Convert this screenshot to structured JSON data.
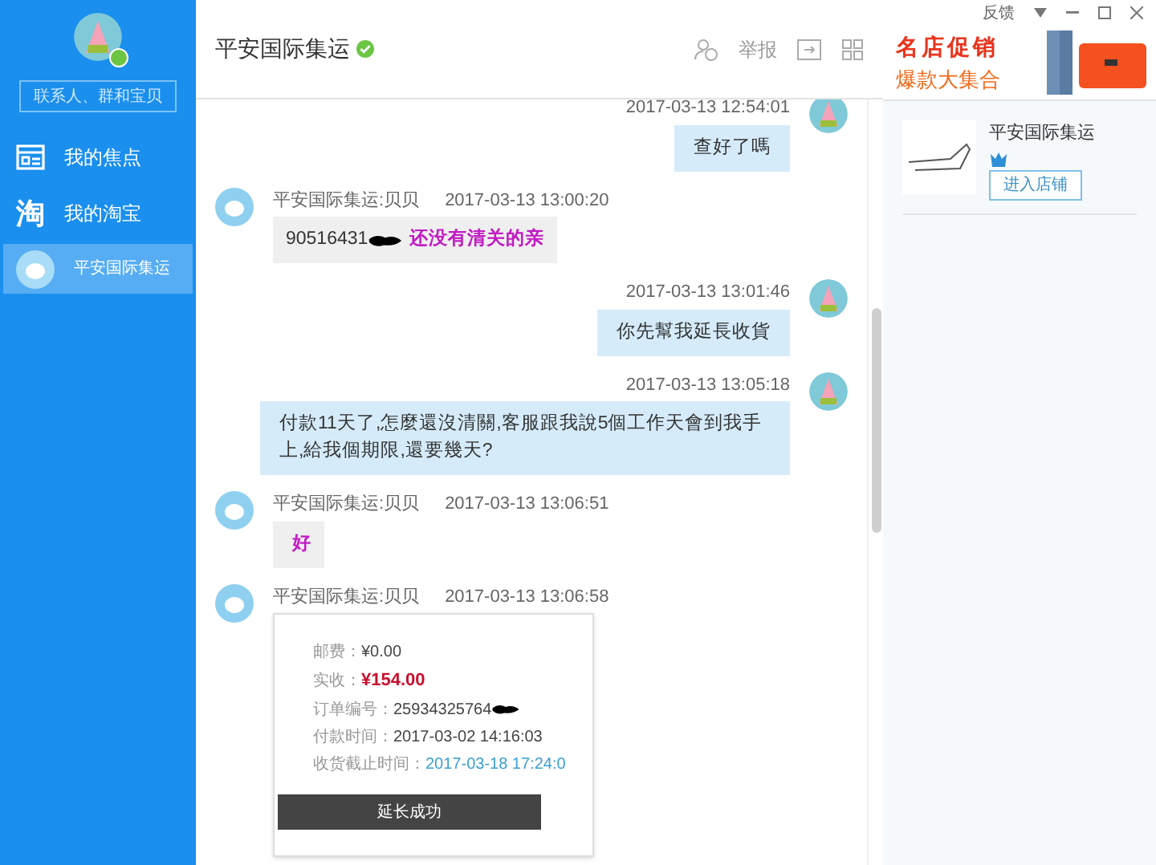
{
  "window": {
    "feedback": "反馈"
  },
  "sidebar": {
    "search": {
      "placeholder": "联系人、群和宝贝"
    },
    "items": [
      {
        "kind": "focus",
        "label": "我的焦点",
        "selected": false
      },
      {
        "kind": "taobao",
        "glyph": "淘",
        "label": "我的淘宝",
        "selected": false
      },
      {
        "kind": "contact",
        "label": "平安国际集运",
        "selected": true
      }
    ]
  },
  "chat": {
    "title": "平安国际集运",
    "verified": true,
    "report": "举报"
  },
  "ad": {
    "line1": "名店促销",
    "line2": "爆款大集合"
  },
  "messages": [
    {
      "kind": "sent",
      "time": "2017-03-13 12:54:01",
      "text": "查好了嗎"
    },
    {
      "kind": "received",
      "sender": "平安国际集运:贝贝",
      "time": "2017-03-13 13:00:20",
      "text": "90516431",
      "redacted": true,
      "highlight": "还没有清关的亲"
    },
    {
      "kind": "sent",
      "time": "2017-03-13 13:01:46",
      "text": "你先幫我延長收貨"
    },
    {
      "kind": "sent",
      "time": "2017-03-13 13:05:18",
      "text": "付款11天了,怎麼還沒清關,客服跟我說5個工作天會到我手上,給我個期限,還要幾天?"
    },
    {
      "kind": "received",
      "sender": "平安国际集运:贝贝",
      "time": "2017-03-13 13:06:51",
      "highlight": "好"
    },
    {
      "kind": "card",
      "sender": "平安国际集运:贝贝",
      "time": "2017-03-13 13:06:58",
      "toast": "延长成功",
      "rows": [
        {
          "kind": "plain",
          "label": "邮费：",
          "value": "¥0.00"
        },
        {
          "kind": "price",
          "label": "实收：",
          "value": "¥154.00"
        },
        {
          "kind": "plain",
          "label": "订单编号：",
          "value": "25934325764",
          "redacted": true
        },
        {
          "kind": "plain",
          "label": "付款时间：",
          "value": "2017-03-02 14:16:03"
        },
        {
          "kind": "link",
          "label": "收货截止时间：",
          "value": "2017-03-18 17:24:0"
        }
      ]
    }
  ],
  "shop": {
    "name": "平安国际集运",
    "button": "进入店铺"
  }
}
